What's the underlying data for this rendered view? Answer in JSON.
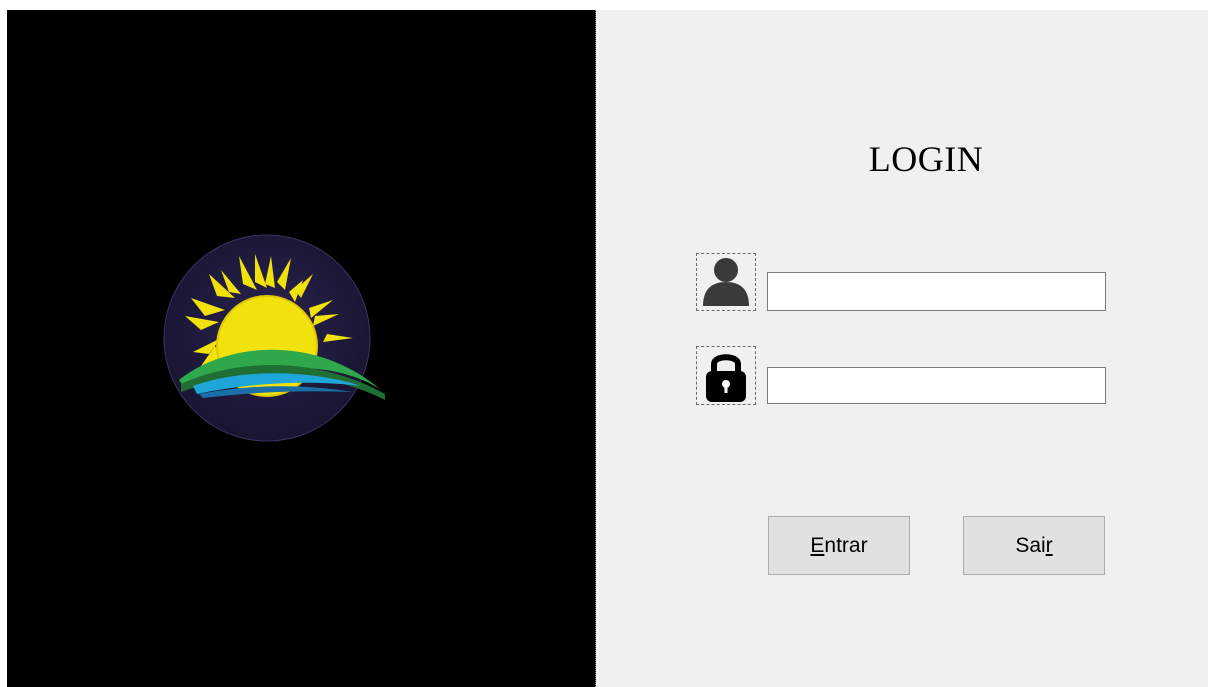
{
  "login": {
    "title": "LOGIN",
    "username_value": "",
    "password_value": "",
    "enter_button": {
      "mnemonic": "E",
      "rest": "ntrar"
    },
    "exit_button": {
      "before": "Sai",
      "mnemonic": "r"
    }
  },
  "icons": {
    "logo": "sun-over-hills-logo",
    "user": "user-icon",
    "lock": "lock-icon"
  },
  "colors": {
    "left_panel": "#000000",
    "form_bg": "#f0f0f0",
    "button_bg": "#e1e1e1",
    "logo_circle": "#1f1a3c",
    "sun": "#f2e20c",
    "hill_green": "#2ea84a",
    "water_blue": "#1fa6d8"
  }
}
